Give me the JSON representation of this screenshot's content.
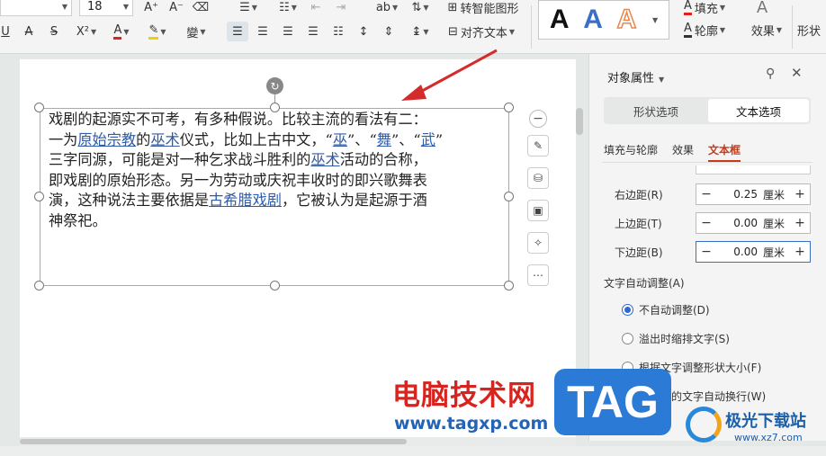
{
  "ribbon": {
    "font_size": "18",
    "superscript": "X²",
    "change_shape": "转智能图形",
    "align_text": "对齐文本",
    "fill": "填充",
    "outline": "轮廓",
    "effect": "效果",
    "shape_partial": "形状",
    "art_letter": "A"
  },
  "document": {
    "lines": [
      [
        {
          "t": "戏剧的起源实不可考，有多种假说。比较主流的看法有二："
        }
      ],
      [
        {
          "t": "一为"
        },
        {
          "t": "原始宗教",
          "l": true
        },
        {
          "t": "的"
        },
        {
          "t": "巫术",
          "l": true
        },
        {
          "t": "仪式，比如上古中文，“"
        },
        {
          "t": "巫",
          "l": true
        },
        {
          "t": "”、“"
        },
        {
          "t": "舞",
          "l": true
        },
        {
          "t": "”、“"
        },
        {
          "t": "武",
          "l": true
        },
        {
          "t": "”"
        }
      ],
      [
        {
          "t": "三字同源，可能是对一种乞求战斗胜利的"
        },
        {
          "t": "巫术",
          "l": true
        },
        {
          "t": "活动的合称，"
        }
      ],
      [
        {
          "t": "即戏剧的原始形态。另一为劳动或庆祝丰收时的即兴歌舞表"
        }
      ],
      [
        {
          "t": "演，这种说法主要依据是"
        },
        {
          "t": "古希腊戏剧",
          "l": true
        },
        {
          "t": "，它被认为是起源于酒"
        }
      ],
      [
        {
          "t": "神祭祀。"
        }
      ]
    ]
  },
  "panel": {
    "title": "对象属性",
    "tabs": [
      "形状选项",
      "文本选项"
    ],
    "subtabs": [
      "填充与轮廓",
      "效果",
      "文本框"
    ],
    "margins": [
      {
        "label": "右边距(R)",
        "value": "0.25",
        "unit": "厘米"
      },
      {
        "label": "上边距(T)",
        "value": "0.00",
        "unit": "厘米"
      },
      {
        "label": "下边距(B)",
        "value": "0.00",
        "unit": "厘米"
      }
    ],
    "autofit_title": "文字自动调整(A)",
    "radios": [
      "不自动调整(D)",
      "溢出时缩排文字(S)",
      "根据文字调整形状大小(F)"
    ],
    "wrap_text": "形状中的文字自动换行(W)"
  },
  "watermark": {
    "site_cn": "电脑技术网",
    "url": "www.tagxp.com",
    "tag": "TAG",
    "logo_cn": "极光下载站",
    "logo_url": "www.xz7.com"
  },
  "colors": {
    "accent": "#c43c1a",
    "link": "#2f5ba8",
    "tag": "#2b7bd6",
    "arrow": "#d42b2b"
  }
}
